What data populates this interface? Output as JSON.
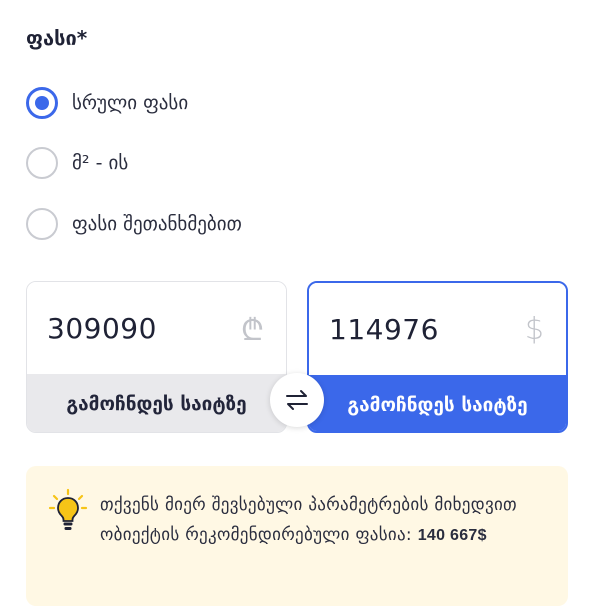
{
  "price_section": {
    "title": "ფასი*",
    "options": [
      {
        "label": "სრული ფასი",
        "selected": true
      },
      {
        "label": "მ² - ის",
        "selected": false
      },
      {
        "label": "ფასი შეთანხმებით",
        "selected": false
      }
    ]
  },
  "price_inputs": {
    "gel": {
      "value": "309090",
      "currency_symbol": "₾",
      "footer_label": "გამოჩნდეს საიტზე",
      "active": false
    },
    "usd": {
      "value": "114976",
      "currency_symbol": "$",
      "footer_label": "გამოჩნდეს საიტზე",
      "active": true
    },
    "swap_icon": "swap-arrows-icon"
  },
  "recommendation": {
    "icon": "lightbulb-icon",
    "text": "თქვენს მიერ შევსებული პარამეტრების მიხედვით ობიექტის რეკომენდირებული ფასია:",
    "amount": "140 667$"
  },
  "colors": {
    "accent": "#3b68ea",
    "hint_background": "#fff8e4",
    "inactive_footer": "#e9e9ec",
    "bulb": "#f6c417"
  }
}
